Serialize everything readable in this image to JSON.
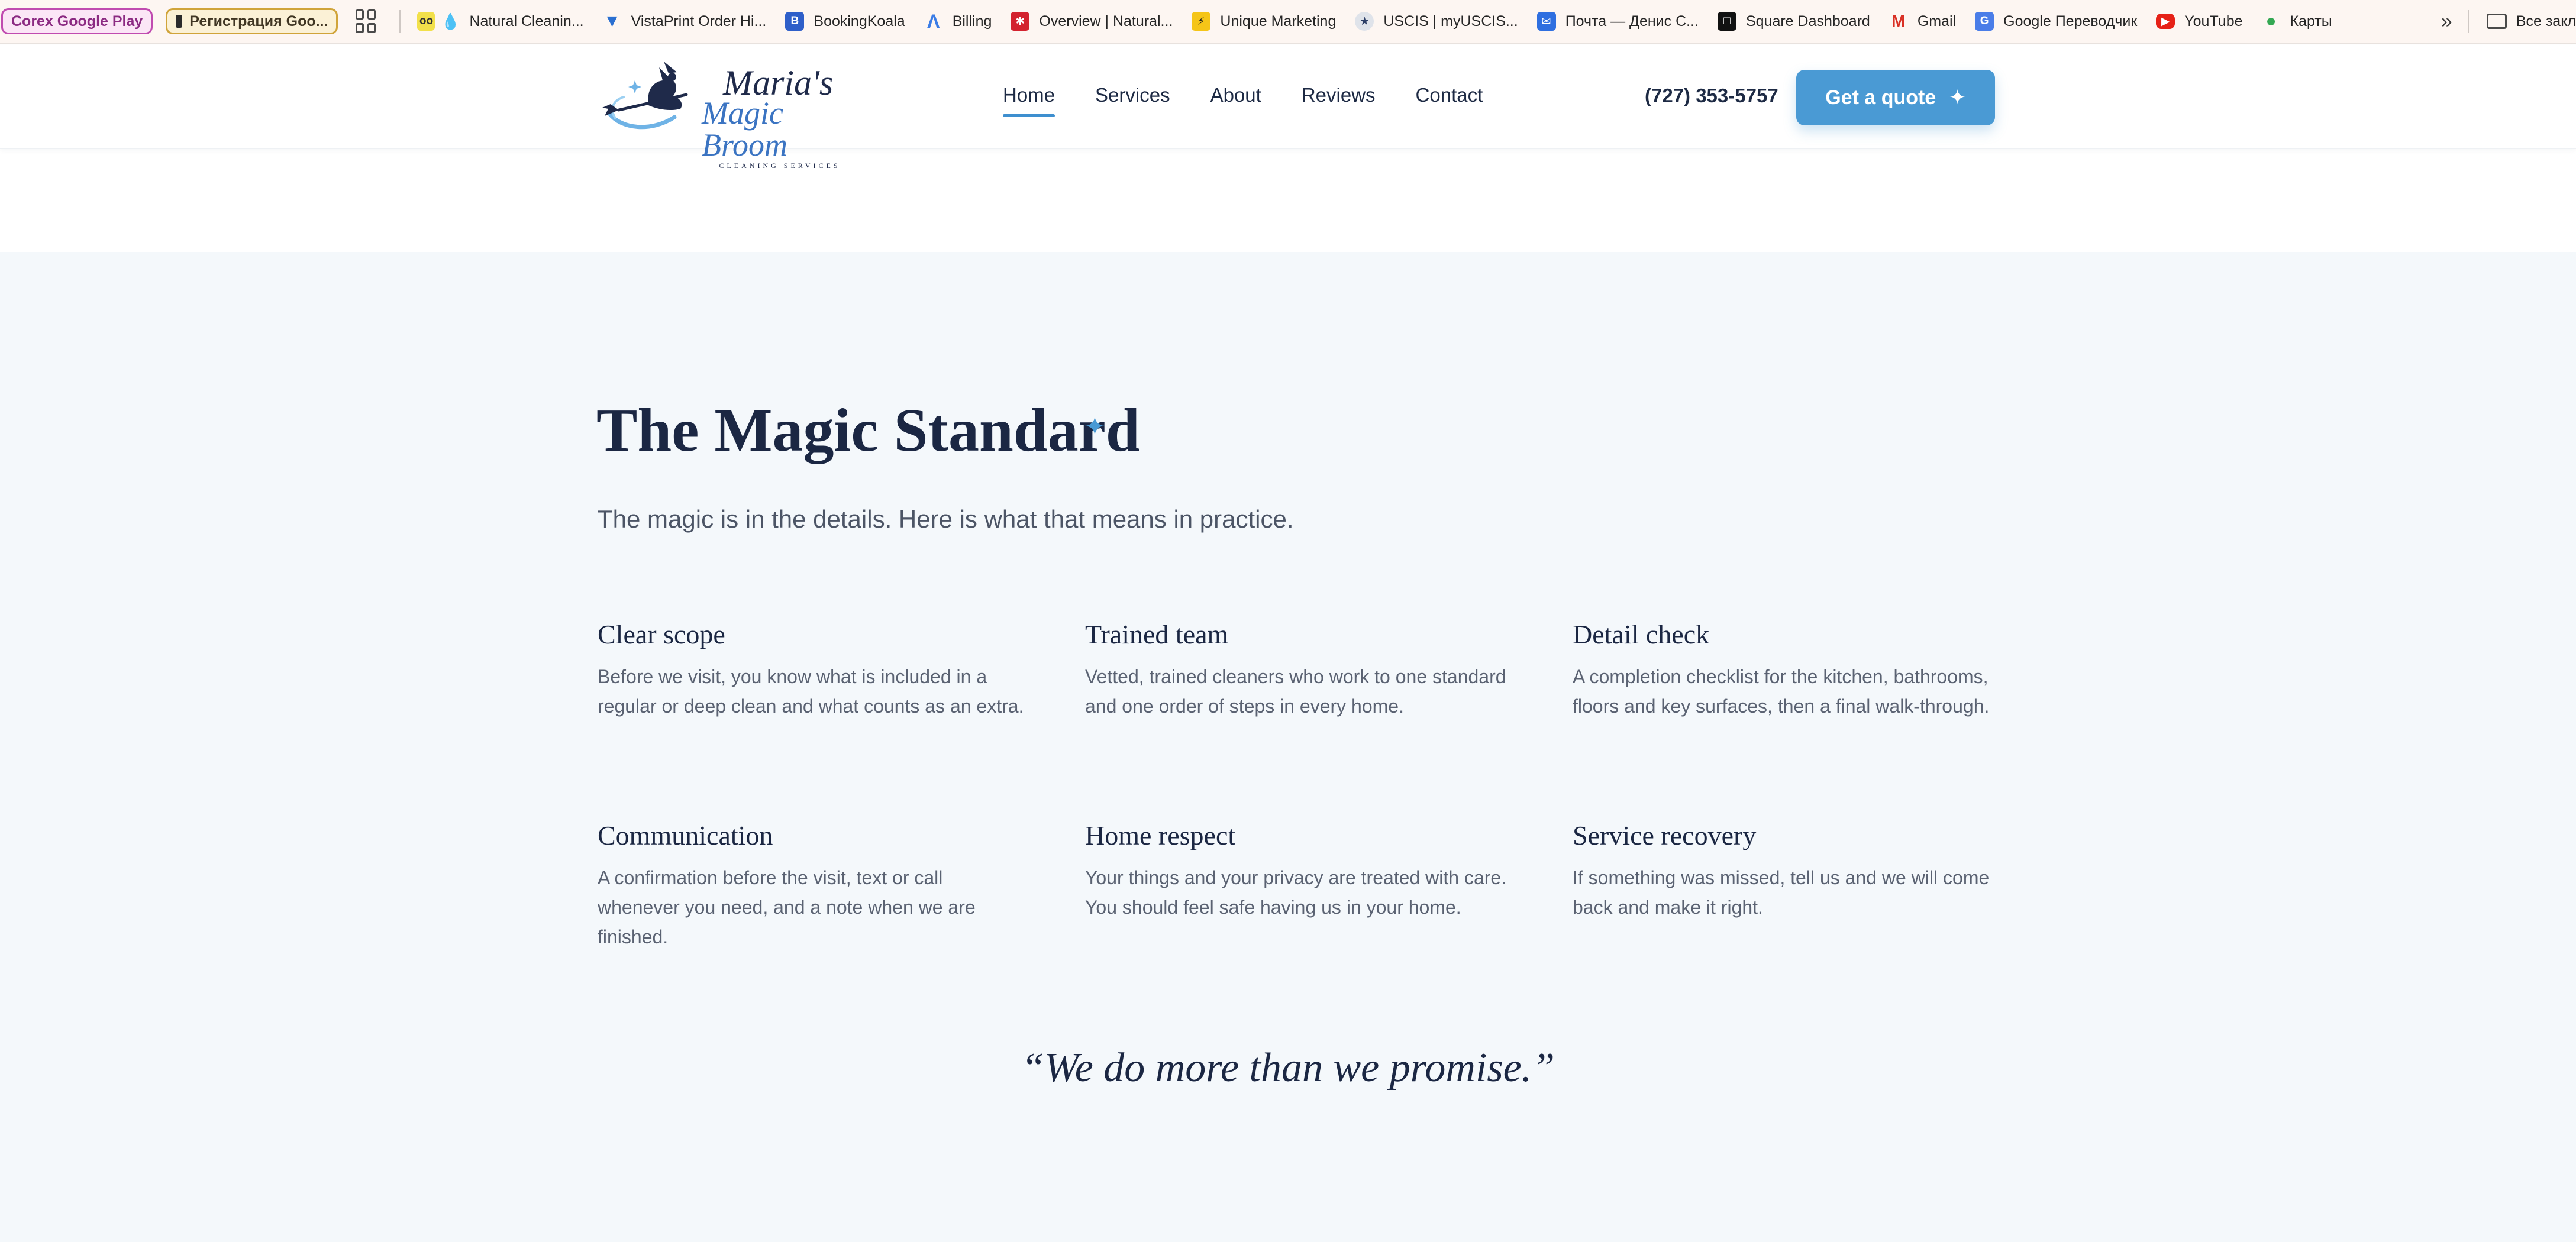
{
  "bookmarks": {
    "chip_1": "Corex Google Play",
    "chip_2": "Регистрация Goo...",
    "items": [
      {
        "label": "Natural Cleanin...",
        "icon": "cleaning-drop-icon"
      },
      {
        "label": "VistaPrint Order Hi...",
        "icon": "vistaprint-icon"
      },
      {
        "label": "BookingKoala",
        "icon": "bookingkoala-icon"
      },
      {
        "label": "Billing",
        "icon": "google-ads-icon"
      },
      {
        "label": "Overview | Natural...",
        "icon": "yelp-icon"
      },
      {
        "label": "Unique Marketing",
        "icon": "lightning-icon"
      },
      {
        "label": "USCIS | myUSCIS...",
        "icon": "uscis-seal-icon"
      },
      {
        "label": "Почта — Денис С...",
        "icon": "mail-icon"
      },
      {
        "label": "Square Dashboard",
        "icon": "square-icon"
      },
      {
        "label": "Gmail",
        "icon": "gmail-icon"
      },
      {
        "label": "Google Переводчик",
        "icon": "translate-icon"
      },
      {
        "label": "YouTube",
        "icon": "youtube-icon"
      },
      {
        "label": "Карты",
        "icon": "maps-pin-icon"
      }
    ],
    "more": "»",
    "folder": "Все закл"
  },
  "header": {
    "logo": {
      "line1": "Maria's",
      "line2": "Magic Broom",
      "line3": "CLEANING SERVICES"
    },
    "nav": [
      "Home",
      "Services",
      "About",
      "Reviews",
      "Contact"
    ],
    "phone": "(727) 353-5757",
    "cta": "Get a quote"
  },
  "section": {
    "title": "The Magic Standard",
    "subtitle": "The magic is in the details. Here is what that means in practice.",
    "features": [
      {
        "title": "Clear scope",
        "text": "Before we visit, you know what is included in a regular or deep clean and what counts as an extra."
      },
      {
        "title": "Trained team",
        "text": "Vetted, trained cleaners who work to one standard and one order of steps in every home."
      },
      {
        "title": "Detail check",
        "text": "A completion checklist for the kitchen, bathrooms, floors and key surfaces, then a final walk-through."
      },
      {
        "title": "Communication",
        "text": "A confirmation before the visit, text or call whenever you need, and a note when we are finished."
      },
      {
        "title": "Home respect",
        "text": "Your things and your privacy are treated with care. You should feel safe having us in your home."
      },
      {
        "title": "Service recovery",
        "text": "If something was missed, tell us and we will come back and make it right."
      }
    ],
    "quote": "“We do more than we promise.”"
  },
  "colors": {
    "accent": "#4a9ad4",
    "heading": "#1b2743",
    "section_bg": "#f4f8fb"
  }
}
